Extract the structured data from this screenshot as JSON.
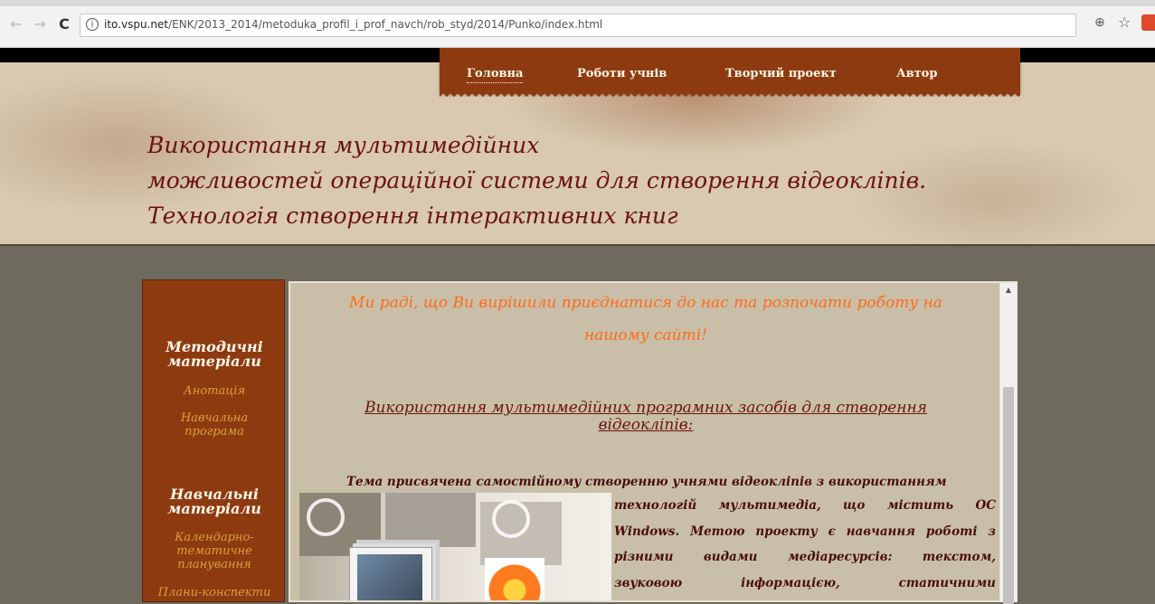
{
  "browser": {
    "url_domain": "ito.vspu.net",
    "url_path": "/ENK/2013_2014/metoduka_profil_i_prof_navch/rob_styd/2014/Punko/index.html",
    "back": "←",
    "forward": "→",
    "reload": "C",
    "info": "i",
    "zoom": "⊕",
    "bookmark": "☆"
  },
  "topnav": {
    "items": [
      "Головна",
      "Роботи учнів",
      "Творчий проект",
      "Автор"
    ]
  },
  "header": {
    "title_lines": [
      "Використання мультимедійних",
      "можливостей операційної системи для створення відеокліпів.",
      "Технологія створення інтерактивних книг"
    ]
  },
  "sidebar": {
    "sections": [
      {
        "heading_lines": [
          "Методичні",
          "матеріали"
        ],
        "links": [
          [
            "Анотація"
          ],
          [
            "Навчальна",
            "програма"
          ]
        ]
      },
      {
        "heading_lines": [
          "Навчальні",
          "матеріали"
        ],
        "links": [
          [
            "Календарно-",
            "тематичне",
            "планування"
          ],
          [
            "Плани-конспекти"
          ]
        ]
      }
    ]
  },
  "content": {
    "welcome_lines": [
      "Ми раді, що Ви вирішили приєднатися до нас та розпочати роботу на",
      "нашому сайті!"
    ],
    "subtitle_lines": [
      "Використання мультимедійних програмних засобів для створення",
      "відеокліпів:"
    ],
    "paragraph_first": "Тема присвячена самостійному створенню учнями відеокліпів з використанням",
    "paragraph_lines": [
      "технологій мультимедіа, що містить ОС",
      "Windows. Метою проекту є навчання роботі з",
      "різними видами медіаресурсів: текстом,",
      "звуковою інформацією, статичними"
    ]
  }
}
